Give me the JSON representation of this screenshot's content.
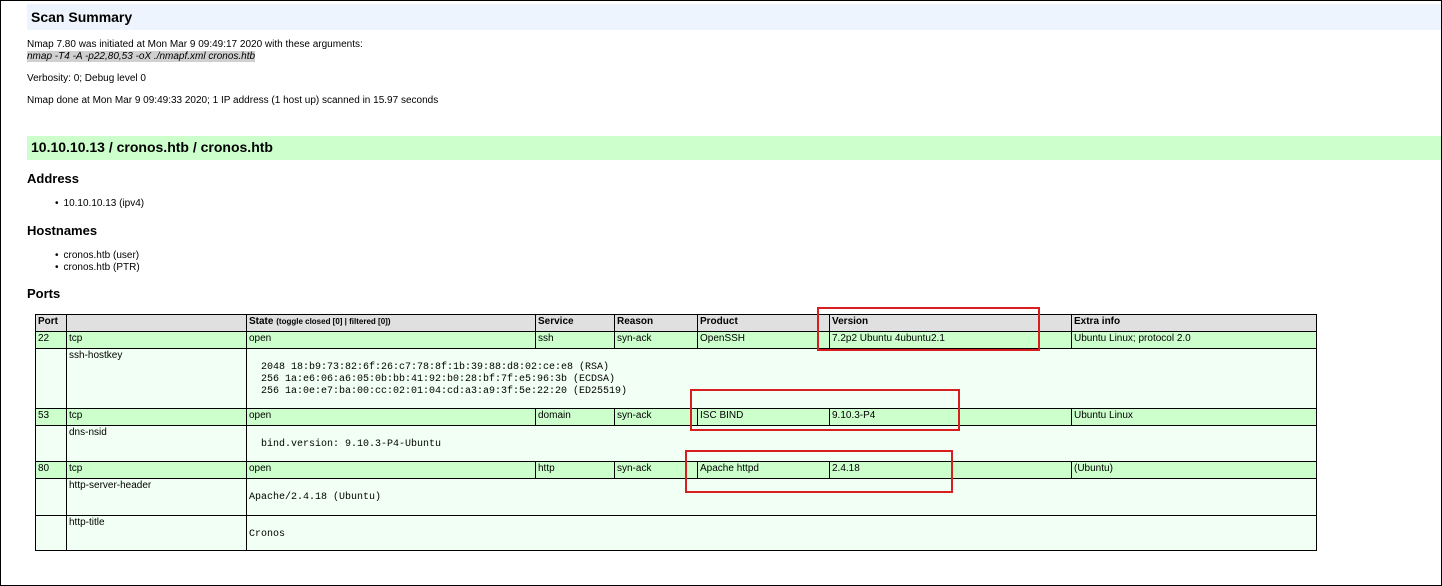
{
  "summary": {
    "title": "Scan Summary",
    "initiated": "Nmap 7.80 was initiated at Mon Mar 9 09:49:17 2020 with these arguments:",
    "arguments": "nmap -T4 -A -p22,80,53 -oX ./nmapf.xml cronos.htb",
    "verbosity": "Verbosity: 0; Debug level 0",
    "done": "Nmap done at Mon Mar 9 09:49:33 2020; 1 IP address (1 host up) scanned in 15.97 seconds"
  },
  "host": {
    "title": "10.10.10.13 / cronos.htb / cronos.htb",
    "address_heading": "Address",
    "address": "10.10.10.13 (ipv4)",
    "hostnames_heading": "Hostnames",
    "hostnames": [
      "cronos.htb (user)",
      "cronos.htb (PTR)"
    ],
    "ports_heading": "Ports"
  },
  "ports_table": {
    "headers": {
      "port": "Port",
      "protocol": "",
      "state": "State",
      "toggle": "(toggle closed [0] | filtered [0])",
      "service": "Service",
      "reason": "Reason",
      "product": "Product",
      "version": "Version",
      "extra": "Extra info"
    },
    "rows": [
      {
        "port": "22",
        "protocol": "tcp",
        "state": "open",
        "service": "ssh",
        "reason": "syn-ack",
        "product": "OpenSSH",
        "version": "7.2p2 Ubuntu 4ubuntu2.1",
        "extra": "Ubuntu Linux; protocol 2.0",
        "scripts": [
          {
            "name": "ssh-hostkey",
            "output": "\n  2048 18:b9:73:82:6f:26:c7:78:8f:1b:39:88:d8:02:ce:e8 (RSA)\n  256 1a:e6:06:a6:05:0b:bb:41:92:b0:28:bf:7f:e5:96:3b (ECDSA)\n  256 1a:0e:e7:ba:00:cc:02:01:04:cd:a3:a9:3f:5e:22:20 (ED25519)\n"
          }
        ]
      },
      {
        "port": "53",
        "protocol": "tcp",
        "state": "open",
        "service": "domain",
        "reason": "syn-ack",
        "product": "ISC BIND",
        "version": "9.10.3-P4",
        "extra": "Ubuntu Linux",
        "scripts": [
          {
            "name": "dns-nsid",
            "output": "\n  bind.version: 9.10.3-P4-Ubuntu\n"
          }
        ]
      },
      {
        "port": "80",
        "protocol": "tcp",
        "state": "open",
        "service": "http",
        "reason": "syn-ack",
        "product": "Apache httpd",
        "version": "2.4.18",
        "extra": "(Ubuntu)",
        "scripts": [
          {
            "name": "http-server-header",
            "output": "\nApache/2.4.18 (Ubuntu)\n"
          },
          {
            "name": "http-title",
            "output": "\nCronos\n"
          }
        ]
      }
    ]
  },
  "colors": {
    "summary_bg": "#eef4fd",
    "host_bg": "#ccffcc",
    "open_row": "#ccffcc",
    "script_row": "#f1fff4",
    "highlight": "#d81e1e"
  }
}
